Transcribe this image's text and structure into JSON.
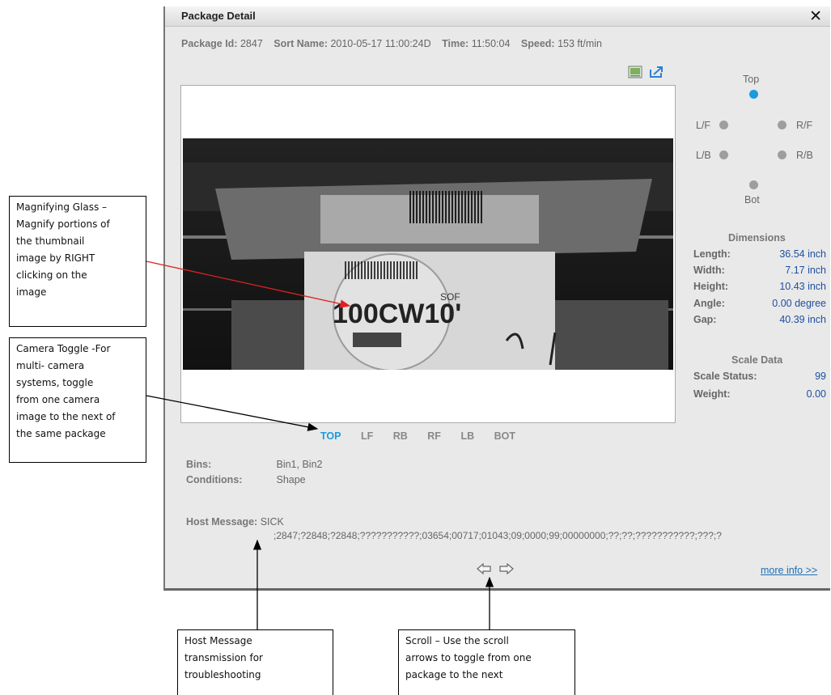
{
  "dialog": {
    "title": "Package Detail",
    "close_glyph": "✕",
    "info": {
      "package_id_label": "Package Id:",
      "package_id": "2847",
      "sort_name_label": "Sort Name:",
      "sort_name": "2010-05-17 11:00:24D",
      "time_label": "Time:",
      "time": "11:50:04",
      "speed_label": "Speed:",
      "speed": "153 ft/min"
    },
    "toolbar_icons": [
      "image-view-icon",
      "export-icon"
    ],
    "image": {
      "label_texts": [
        "100CW10'",
        "SOF"
      ]
    },
    "camera_tabs": [
      "TOP",
      "LF",
      "RB",
      "RF",
      "LB",
      "BOT"
    ],
    "active_tab": "TOP",
    "bins_label": "Bins:",
    "bins_value": "Bin1, Bin2",
    "conditions_label": "Conditions:",
    "conditions_value": "Shape",
    "host_message_label": "Host Message:",
    "host_message_line1": "SICK",
    "host_message_line2": ";2847;?2848;?2848;???????????;03654;00717;01043;09;0000;99;00000000;??;??;???????????;???;?",
    "more_info": "more info >>",
    "camera_positions": {
      "top": "Top",
      "lf": "L/F",
      "rf": "R/F",
      "lb": "L/B",
      "rb": "R/B",
      "bot": "Bot",
      "active": "Top",
      "active_color": "#1a9be0"
    },
    "dimensions": {
      "heading": "Dimensions",
      "rows": [
        {
          "label": "Length:",
          "value": "36.54 inch"
        },
        {
          "label": "Width:",
          "value": "7.17 inch"
        },
        {
          "label": "Height:",
          "value": "10.43 inch"
        },
        {
          "label": "Angle:",
          "value": "0.00 degree"
        },
        {
          "label": "Gap:",
          "value": "40.39 inch"
        }
      ]
    },
    "scale": {
      "heading": "Scale Data",
      "rows": [
        {
          "label": "Scale Status:",
          "value": "99"
        },
        {
          "label": "Weight:",
          "value": "0.00"
        }
      ]
    }
  },
  "callouts": {
    "magnifier": [
      "Magnifying Glass –",
      "Magnify portions of",
      "the thumbnail",
      "image by RIGHT",
      "clicking on the",
      "image"
    ],
    "camera_toggle": [
      "Camera Toggle -For",
      "multi- camera",
      "systems, toggle",
      "from one camera",
      "image to the next of",
      "the same package"
    ],
    "host_message": [
      "Host Message",
      "transmission for",
      "troubleshooting"
    ],
    "scroll": [
      "Scroll – Use the scroll",
      "arrows to toggle from one",
      "package to the next"
    ]
  }
}
